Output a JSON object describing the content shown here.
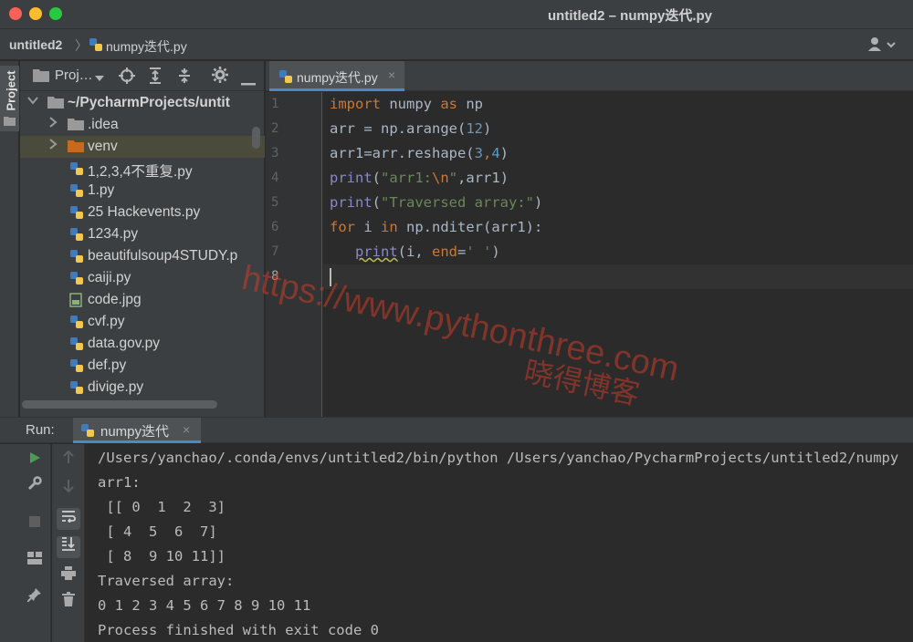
{
  "window": {
    "title": "untitled2 – numpy迭代.py"
  },
  "navbar": {
    "project": "untitled2",
    "separator": "〉",
    "file": "numpy迭代.py"
  },
  "left_strip": {
    "project_tab": "Project"
  },
  "project_panel": {
    "title": "Proj…",
    "tree": [
      {
        "label": "~/PycharmProjects/untit",
        "kind": "folder-root",
        "expanded": true
      },
      {
        "label": ".idea",
        "kind": "folder"
      },
      {
        "label": "venv",
        "kind": "folder-orange",
        "selected": true
      },
      {
        "label": "1,2,3,4不重复.py",
        "kind": "python-file"
      },
      {
        "label": "1.py",
        "kind": "python-file"
      },
      {
        "label": "25 Hackevents.py",
        "kind": "python-file"
      },
      {
        "label": "1234.py",
        "kind": "python-file"
      },
      {
        "label": "beautifulsoup4STUDY.p",
        "kind": "python-file"
      },
      {
        "label": "caiji.py",
        "kind": "python-file"
      },
      {
        "label": "code.jpg",
        "kind": "image-file"
      },
      {
        "label": "cvf.py",
        "kind": "python-file"
      },
      {
        "label": "data.gov.py",
        "kind": "python-file"
      },
      {
        "label": "def.py",
        "kind": "python-file"
      },
      {
        "label": "divige.py",
        "kind": "python-file"
      }
    ]
  },
  "editor": {
    "tab_label": "numpy迭代.py",
    "line_numbers": [
      "1",
      "2",
      "3",
      "4",
      "5",
      "6",
      "7",
      "8"
    ],
    "code": {
      "l1_kw": "import",
      "l1_rest": " numpy ",
      "l1_as": "as",
      "l1_np": " np",
      "l2_a": "arr = np.arange(",
      "l2_num": "12",
      "l2_b": ")",
      "l3_a": "arr1=arr.reshape(",
      "l3_n1": "3",
      "l3_comma": ",",
      "l3_n2": "4",
      "l3_b": ")",
      "l4_fn": "print",
      "l4_a": "(",
      "l4_s1": "\"arr1:",
      "l4_esc": "\\n",
      "l4_s2": "\"",
      "l4_b": ",arr1)",
      "l5_fn": "print",
      "l5_a": "(",
      "l5_str": "\"Traversed array:\"",
      "l5_b": ")",
      "l6_for": "for",
      "l6_a": " i ",
      "l6_in": "in",
      "l6_b": " np.nditer(arr1):",
      "l7_indent": "   ",
      "l7_fn": "print",
      "l7_a": "(i, ",
      "l7_end": "end",
      "l7_eq": "=",
      "l7_str": "' '",
      "l7_b": ")"
    }
  },
  "watermark": {
    "url": "https://www.pythonthree.com",
    "cn": "晓得博客"
  },
  "run_panel": {
    "title": "Run:",
    "tab_label": "numpy迭代",
    "output": [
      "/Users/yanchao/.conda/envs/untitled2/bin/python /Users/yanchao/PycharmProjects/untitled2/numpy",
      "arr1:",
      " [[ 0  1  2  3]",
      " [ 4  5  6  7]",
      " [ 8  9 10 11]]",
      "Traversed array:",
      "0 1 2 3 4 5 6 7 8 9 10 11",
      "Process finished with exit code 0"
    ]
  },
  "icons": {
    "close": "×",
    "chevron_right": "›",
    "chevron_down": "⌄"
  },
  "colors": {
    "background": "#2b2b2b",
    "panel": "#3c3f41",
    "keyword": "#cc7832",
    "number": "#6897bb",
    "string": "#6a8759",
    "builtin": "#8888c6",
    "run_green": "#499c54",
    "watermark": "#c83c28"
  }
}
